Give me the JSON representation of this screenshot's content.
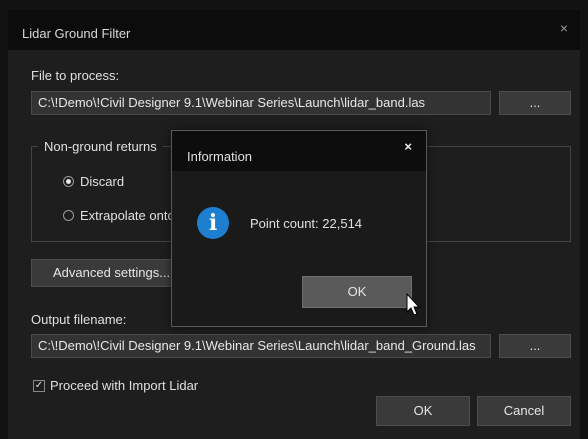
{
  "dialog": {
    "title": "Lidar Ground Filter",
    "close": "×",
    "file_label": "File to process:",
    "file_value": "C:\\!Demo\\!Civil Designer 9.1\\Webinar Series\\Launch\\lidar_band.las",
    "browse_label": "...",
    "group_title": "Non-ground returns",
    "radio_discard": "Discard",
    "radio_extrapolate": "Extrapolate onto",
    "advanced_label": "Advanced settings...",
    "output_label": "Output filename:",
    "output_value": "C:\\!Demo\\!Civil Designer 9.1\\Webinar Series\\Launch\\lidar_band_Ground.las",
    "proceed_label": "Proceed with Import Lidar",
    "proceed_checked": true,
    "ok_label": "OK",
    "cancel_label": "Cancel"
  },
  "info": {
    "title": "Information",
    "close": "×",
    "icon": "i",
    "message": "Point count: 22,514",
    "ok_label": "OK"
  },
  "colors": {
    "background": "#1e1e1e",
    "titlebar": "#0c0c0c",
    "info_icon": "#1e7fd1",
    "field": "#333333"
  }
}
